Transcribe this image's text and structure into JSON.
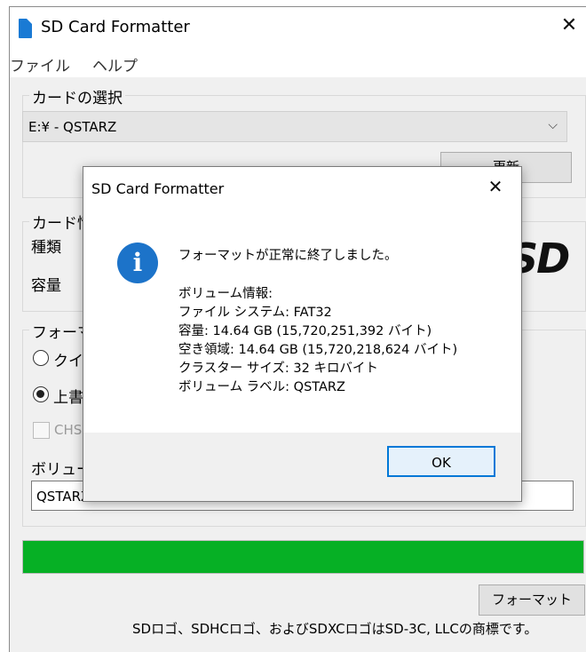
{
  "window": {
    "title": "SD Card Formatter",
    "close_glyph": "✕",
    "menu": {
      "file": "ファイル",
      "help": "ヘルプ"
    }
  },
  "card_select": {
    "group_label": "カードの選択",
    "drive_value": "E:¥ - QSTARZ",
    "dropdown_glyph": "⌵",
    "refresh_label": "更新"
  },
  "card_info": {
    "group_label": "カード情報",
    "type_label": "種類",
    "capacity_label": "容量",
    "logo_text": "SD"
  },
  "format_options": {
    "group_label": "フォーマットオプション",
    "quick_label": "クイックフォーマット",
    "overwrite_label": "上書きフォーマット",
    "overwrite_selected": true,
    "chs_label": "CHS",
    "volume_label_caption": "ボリュームラベル",
    "volume_label_value": "QSTARZ"
  },
  "progress": {
    "value_percent": 100,
    "color": "#06b025"
  },
  "format_button_label": "フォーマット",
  "footer_text": "SDロゴ、SDHCロゴ、およびSDXCロゴはSD-3C, LLCの商標です。",
  "dialog": {
    "title": "SD Card Formatter",
    "close_glyph": "✕",
    "icon": "info-icon",
    "icon_glyph": "i",
    "message": "フォーマットが正常に終了しました。",
    "lines": [
      "ボリューム情報:",
      "ファイル システム: FAT32",
      "容量: 14.64 GB (15,720,251,392 バイト)",
      "空き領域: 14.64 GB (15,720,218,624 バイト)",
      "クラスター サイズ: 32 キロバイト",
      "ボリューム ラベル: QSTARZ"
    ],
    "ok_label": "OK"
  }
}
